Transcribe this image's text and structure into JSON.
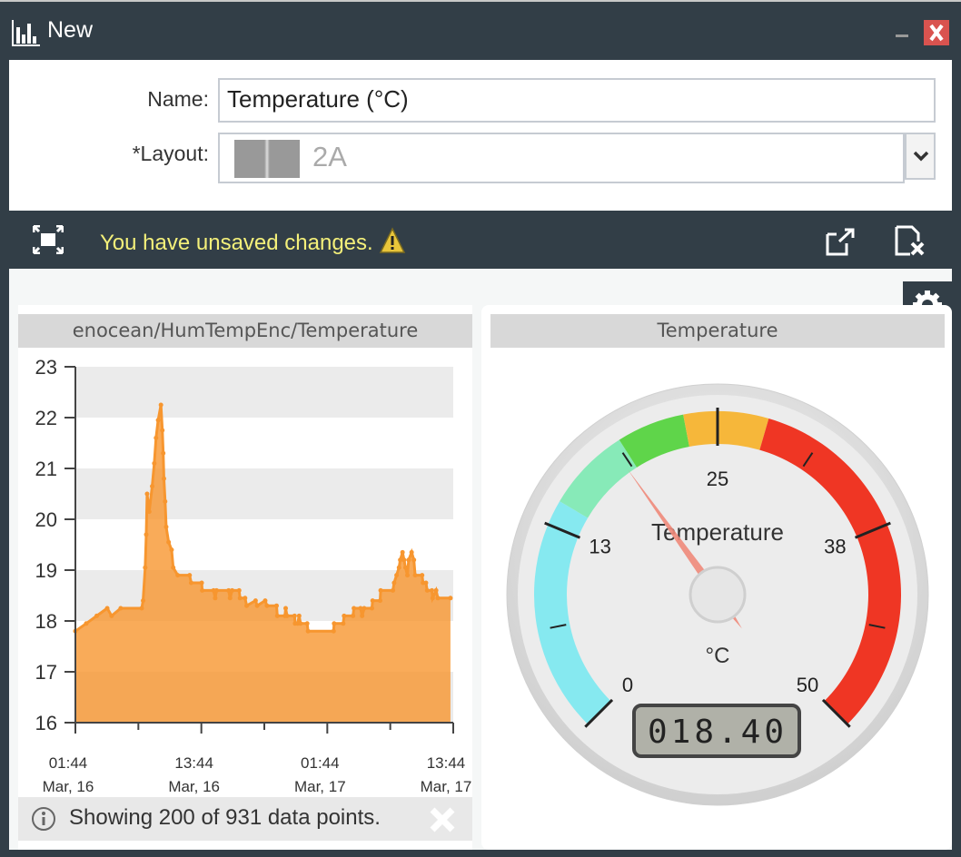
{
  "window": {
    "title": "New",
    "icon": "bar-chart-icon",
    "minimize_icon": "minimize-icon",
    "close_icon": "close-icon"
  },
  "form": {
    "name_label": "Name:",
    "name_value": "Temperature (°C)",
    "layout_label": "*Layout:",
    "layout_value": "2A",
    "layout_icon": "two-column-layout-icon"
  },
  "toolbar": {
    "unsaved_text": "You have unsaved changes.",
    "warning_icon": "warning-icon",
    "fullscreen_icon": "fullscreen-icon",
    "export_icon": "export-icon",
    "discard_icon": "discard-file-icon",
    "unsaved_color": "#f4f07a"
  },
  "settings_icon": "gear-icon",
  "chart_panel": {
    "title": "enocean/HumTempEnc/Temperature",
    "info_text": "Showing 200 of 931 data points.",
    "info_icon": "info-icon",
    "dismiss_icon": "close-icon"
  },
  "gauge_panel": {
    "title": "Temperature"
  },
  "chart_data": [
    {
      "type": "area",
      "color": "#f7962f",
      "ylim": [
        16,
        23
      ],
      "yticks": [
        16,
        17,
        18,
        19,
        20,
        21,
        22,
        23
      ],
      "xlim": [
        "03-16 01:44",
        "03-17 13:44"
      ],
      "xticks": [
        {
          "t": "03-16 01:44",
          "l1": "01:44",
          "l2": "Mar, 16"
        },
        {
          "t": "03-16 13:44",
          "l1": "13:44",
          "l2": "Mar, 16"
        },
        {
          "t": "03-17 01:44",
          "l1": "01:44",
          "l2": "Mar, 17"
        },
        {
          "t": "03-17 13:44",
          "l1": "13:44",
          "l2": "Mar, 17"
        }
      ],
      "minor_xticks": [
        "03-16 07:44",
        "03-16 19:44",
        "03-17 07:44"
      ],
      "grid_bands": true,
      "points": [
        [
          "03-16 01:44",
          17.8
        ],
        [
          "03-16 02:46",
          17.95
        ],
        [
          "03-16 03:46",
          18.1
        ],
        [
          "03-16 04:46",
          18.25
        ],
        [
          "03-16 05:11",
          18.1
        ],
        [
          "03-16 06:03",
          18.25
        ],
        [
          "03-16 08:03",
          18.25
        ],
        [
          "03-16 08:11",
          18.4
        ],
        [
          "03-16 08:23",
          19.05
        ],
        [
          "03-16 08:29",
          19.7
        ],
        [
          "03-16 08:34",
          20.5
        ],
        [
          "03-16 08:46",
          20.15
        ],
        [
          "03-16 09:03",
          20.65
        ],
        [
          "03-16 09:15",
          21.1
        ],
        [
          "03-16 09:25",
          21.6
        ],
        [
          "03-16 09:37",
          21.95
        ],
        [
          "03-16 09:53",
          22.25
        ],
        [
          "03-16 10:01",
          21.75
        ],
        [
          "03-16 10:06",
          21.3
        ],
        [
          "03-16 10:10",
          20.8
        ],
        [
          "03-16 10:17",
          20.35
        ],
        [
          "03-16 10:23",
          19.85
        ],
        [
          "03-16 10:37",
          19.55
        ],
        [
          "03-16 10:54",
          19.4
        ],
        [
          "03-16 11:03",
          19.05
        ],
        [
          "03-16 11:29",
          18.9
        ],
        [
          "03-16 12:37",
          18.9
        ],
        [
          "03-16 12:46",
          18.75
        ],
        [
          "03-16 13:46",
          18.75
        ],
        [
          "03-16 13:49",
          18.6
        ],
        [
          "03-16 14:54",
          18.6
        ],
        [
          "03-16 15:03",
          18.45
        ],
        [
          "03-16 15:11",
          18.6
        ],
        [
          "03-16 16:20",
          18.6
        ],
        [
          "03-16 16:28",
          18.45
        ],
        [
          "03-16 16:40",
          18.6
        ],
        [
          "03-16 17:20",
          18.6
        ],
        [
          "03-16 17:25",
          18.45
        ],
        [
          "03-16 17:54",
          18.45
        ],
        [
          "03-16 18:03",
          18.3
        ],
        [
          "03-16 18:54",
          18.4
        ],
        [
          "03-16 19:03",
          18.3
        ],
        [
          "03-16 19:49",
          18.4
        ],
        [
          "03-16 19:59",
          18.3
        ],
        [
          "03-16 20:54",
          18.3
        ],
        [
          "03-16 20:58",
          18.1
        ],
        [
          "03-16 21:42",
          18.1
        ],
        [
          "03-16 21:46",
          18.25
        ],
        [
          "03-16 21:54",
          18.1
        ],
        [
          "03-16 22:37",
          18.1
        ],
        [
          "03-16 22:40",
          17.95
        ],
        [
          "03-16 22:54",
          17.95
        ],
        [
          "03-16 23:03",
          18.1
        ],
        [
          "03-16 23:11",
          17.95
        ],
        [
          "03-16 23:49",
          17.95
        ],
        [
          "03-16 23:54",
          17.8
        ],
        [
          "03-17 02:20",
          17.8
        ],
        [
          "03-17 02:23",
          17.95
        ],
        [
          "03-17 03:15",
          17.95
        ],
        [
          "03-17 03:20",
          18.1
        ],
        [
          "03-17 04:11",
          18.1
        ],
        [
          "03-17 04:16",
          18.25
        ],
        [
          "03-17 04:54",
          18.25
        ],
        [
          "03-17 05:03",
          18.1
        ],
        [
          "03-17 05:15",
          18.25
        ],
        [
          "03-17 05:59",
          18.25
        ],
        [
          "03-17 06:03",
          18.4
        ],
        [
          "03-17 06:46",
          18.4
        ],
        [
          "03-17 06:49",
          18.6
        ],
        [
          "03-17 07:59",
          18.6
        ],
        [
          "03-17 08:06",
          18.75
        ],
        [
          "03-17 08:20",
          18.9
        ],
        [
          "03-17 08:34",
          19.05
        ],
        [
          "03-17 08:41",
          19.2
        ],
        [
          "03-17 08:54",
          19.35
        ],
        [
          "03-17 09:03",
          19.2
        ],
        [
          "03-17 09:11",
          19.05
        ],
        [
          "03-17 09:22",
          18.9
        ],
        [
          "03-17 09:29",
          19.2
        ],
        [
          "03-17 09:46",
          19.35
        ],
        [
          "03-17 09:59",
          19.2
        ],
        [
          "03-17 10:06",
          18.9
        ],
        [
          "03-17 10:46",
          18.9
        ],
        [
          "03-17 10:51",
          18.75
        ],
        [
          "03-17 11:08",
          18.75
        ],
        [
          "03-17 11:15",
          18.6
        ],
        [
          "03-17 11:42",
          18.6
        ],
        [
          "03-17 11:46",
          18.45
        ],
        [
          "03-17 12:06",
          18.6
        ],
        [
          "03-17 12:16",
          18.45
        ],
        [
          "03-17 13:28",
          18.45
        ]
      ]
    },
    {
      "type": "gauge",
      "title": "Temperature",
      "unit": "°C",
      "min": 0,
      "max": 50,
      "value": 18.4,
      "display": "018.40",
      "major_labels": [
        "0",
        "13",
        "25",
        "38",
        "50"
      ],
      "bands": [
        {
          "from": 0,
          "to": 14,
          "color": "#86e9f0"
        },
        {
          "from": 14,
          "to": 19,
          "color": "#87eab8"
        },
        {
          "from": 19,
          "to": 23,
          "color": "#5fd54a"
        },
        {
          "from": 23,
          "to": 28,
          "color": "#f6b73a"
        },
        {
          "from": 28,
          "to": 50,
          "color": "#ef3624"
        }
      ]
    }
  ]
}
